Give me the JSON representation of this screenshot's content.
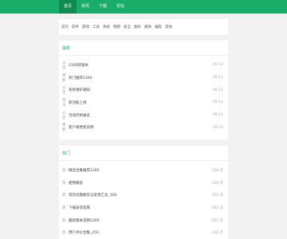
{
  "nav": {
    "items": [
      "首页",
      "资讯",
      "下载",
      "论坛"
    ]
  },
  "breadcrumb": [
    "首页",
    "软件",
    "游戏",
    "工具",
    "系统",
    "网络",
    "安全",
    "图形",
    "媒体",
    "编程",
    "其他"
  ],
  "sections": [
    {
      "title": "最新",
      "items": [
        {
          "tag": "公告",
          "text": "2300新版本",
          "date": "09-12"
        },
        {
          "tag": "更新",
          "text": "热门推荐2300",
          "date": "09-12"
        },
        {
          "tag": "公告",
          "text": "系统维护通知",
          "date": "09-12"
        },
        {
          "tag": "资讯",
          "text": "新功能上线",
          "date": "09-11"
        },
        {
          "tag": "公告",
          "text": "活动开始报名",
          "date": "09-11"
        },
        {
          "tag": "更新",
          "text": "客户端更新说明",
          "date": "09-10"
        }
      ]
    },
    {
      "title": "热门",
      "items": [
        {
          "tag": "热",
          "text": "精选合集推荐2300",
          "date": "358 次"
        },
        {
          "tag": "热",
          "text": "使用教程",
          "date": "326 次"
        },
        {
          "tag": "热",
          "text": "常见问题解答与反馈汇总_100",
          "date": "304 次"
        },
        {
          "tag": "热",
          "text": "下载安装指南",
          "date": "282 次"
        },
        {
          "tag": "热",
          "text": "最新版本说明2300",
          "date": "265 次"
        },
        {
          "tag": "热",
          "text": "用户评价合集_250",
          "date": "238 次"
        }
      ]
    }
  ]
}
